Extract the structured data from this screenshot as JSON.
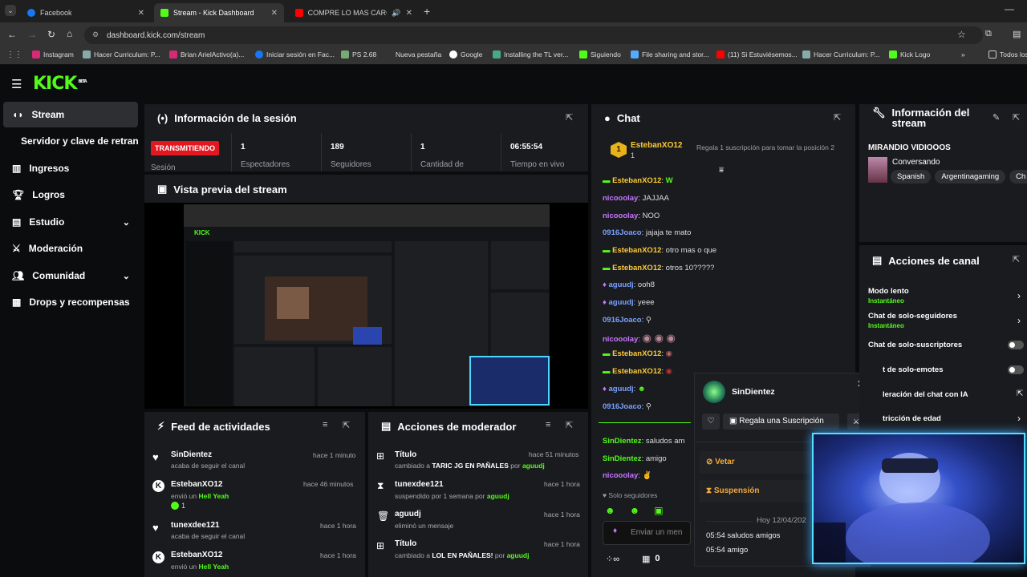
{
  "browser": {
    "tabs": [
      {
        "label": "Facebook"
      },
      {
        "label": "Stream - Kick Dashboard"
      },
      {
        "label": "COMPRE LO MAS CARO EN"
      }
    ],
    "url": "dashboard.kick.com/stream",
    "bookmarks": [
      "Instagram",
      "Hacer Curriculum: P...",
      "Brian ArielActivo(a)...",
      "Iniciar sesión en Fac...",
      "PS 2.68",
      "Nueva pestaña",
      "Google",
      "Installing the TL ver...",
      "Siguiendo",
      "File sharing and stor...",
      "(11) Si Estuviésemos...",
      "Hacer Curriculum: P...",
      "Kick Logo"
    ],
    "bookmarks_folder": "Todos los"
  },
  "kick": {
    "logo": "KICK",
    "logo_sup": "BETA"
  },
  "sidebar": {
    "items": [
      {
        "label": "Stream"
      },
      {
        "label": "Servidor y clave de retransm"
      },
      {
        "label": "Ingresos"
      },
      {
        "label": "Logros"
      },
      {
        "label": "Estudio"
      },
      {
        "label": "Moderación"
      },
      {
        "label": "Comunidad"
      },
      {
        "label": "Drops y recompensas"
      }
    ]
  },
  "session": {
    "title": "Información de la sesión",
    "live_badge": "TRANSMITIENDO",
    "live_label": "Sesión",
    "stats": [
      {
        "value": "1",
        "label": "Espectadores"
      },
      {
        "value": "189",
        "label": "Seguidores"
      },
      {
        "value": "1",
        "label": "Cantidad de"
      },
      {
        "value": "06:55:54",
        "label": "Tiempo en vivo"
      }
    ]
  },
  "preview": {
    "title": "Vista previa del stream"
  },
  "feed": {
    "title": "Feed de actividades",
    "items": [
      {
        "name": "SinDientez",
        "sub": "acaba de seguir el canal",
        "time": "hace 1 minuto"
      },
      {
        "name": "EstebanXO12",
        "sub_pre": "envió un",
        "sub_hl": "Hell Yeah",
        "extra": "1",
        "time": "hace 46 minutos"
      },
      {
        "name": "tunexdee121",
        "sub": "acaba de seguir el canal",
        "time": "hace 1 hora"
      },
      {
        "name": "EstebanXO12",
        "sub_pre": "envió un",
        "sub_hl": "Hell Yeah",
        "time": "hace 1 hora"
      }
    ]
  },
  "modactions": {
    "title": "Acciones de moderador",
    "items": [
      {
        "name": "Título",
        "sub_pre": "cambiado a",
        "sub_bold": "TARIC JG EN PAÑALES",
        "sub_mid": "por",
        "sub_user": "aguudj",
        "time": "hace 51 minutos"
      },
      {
        "name": "tunexdee121",
        "sub_pre": "suspendido por 1 semana por",
        "sub_user": "aguudj",
        "time": "hace 1 hora"
      },
      {
        "name": "aguudj",
        "sub_pre": "eliminó un mensaje",
        "time": "hace 1 hora"
      },
      {
        "name": "Título",
        "sub_pre": "cambiado a",
        "sub_bold": "LOL EN PAÑALES!",
        "sub_mid": "por",
        "sub_user": "aguudj",
        "time": "hace 1 hora"
      }
    ]
  },
  "chat": {
    "title": "Chat",
    "pinned_rank": "1",
    "pinned_user": "EstebanXO12",
    "pinned_count": "1",
    "pinned_note": "Regala 1 suscripción para tomar la posición 2",
    "messages": [
      {
        "user": "EstebanXO12",
        "color": "g",
        "text": ""
      },
      {
        "user": "nicooolay",
        "color": "p",
        "text": "JAJJAA"
      },
      {
        "user": "nicooolay",
        "color": "p",
        "text": "NOO"
      },
      {
        "user": "0916Joaco",
        "color": "b",
        "text": "jajaja te mato"
      },
      {
        "user": "EstebanXO12",
        "color": "g",
        "text": "otro mas o que"
      },
      {
        "user": "EstebanXO12",
        "color": "g",
        "text": "otros 10?????"
      },
      {
        "user": "aguudj",
        "color": "b",
        "text": "ooh8"
      },
      {
        "user": "aguudj",
        "color": "b",
        "text": "yeee"
      },
      {
        "user": "0916Joaco",
        "color": "b",
        "text": ""
      },
      {
        "user": "nicooolay",
        "color": "p",
        "text": ""
      },
      {
        "user": "EstebanXO12",
        "color": "g",
        "text": ""
      },
      {
        "user": "EstebanXO12",
        "color": "g",
        "text": ""
      },
      {
        "user": "aguudj",
        "color": "b",
        "text": ""
      },
      {
        "user": "0916Joaco",
        "color": "b",
        "text": ""
      },
      {
        "user": "SinDientez",
        "color": "g",
        "text": "saludos am"
      },
      {
        "user": "SinDientez",
        "color": "g",
        "text": "amigo"
      },
      {
        "user": "nicooolay",
        "color": "p",
        "text": ""
      }
    ],
    "followers_only": "Solo seguidores",
    "input_placeholder": "Enviar un men",
    "footer_count": "0"
  },
  "usercard": {
    "name": "SinDientez",
    "gift_button": "Regala una Suscripción",
    "veto": "Vetar",
    "suspend": "Suspensión",
    "date": "Hoy 12/04/202",
    "log": [
      {
        "time": "05:54",
        "text": "saludos amigos"
      },
      {
        "time": "05:54",
        "text": "amigo"
      }
    ]
  },
  "streaminfo": {
    "title": "Información del stream",
    "stream_title": "MIRANDIO VIDIOOOS",
    "category": "Conversando",
    "tags": [
      "Spanish",
      "Argentinagaming",
      "Ch"
    ]
  },
  "channel": {
    "title": "Acciones de canal",
    "items": [
      {
        "label": "Modo lento",
        "sub": "Instantáneo",
        "kind": "arrow"
      },
      {
        "label": "Chat de solo-seguidores",
        "sub": "Instantáneo",
        "kind": "arrow"
      },
      {
        "label": "Chat de solo-suscriptores",
        "sub": "",
        "kind": "toggle"
      },
      {
        "label": "t de solo-emotes",
        "sub": "",
        "kind": "toggle"
      },
      {
        "label": "leración del chat con IA",
        "sub": "",
        "kind": "ext"
      },
      {
        "label": "tricción de edad",
        "sub": "",
        "kind": "arrow"
      }
    ]
  },
  "colors": {
    "accent": "#53fc18",
    "live": "#e3171f",
    "panel": "#191b1f",
    "bg": "#0b0c0e"
  }
}
